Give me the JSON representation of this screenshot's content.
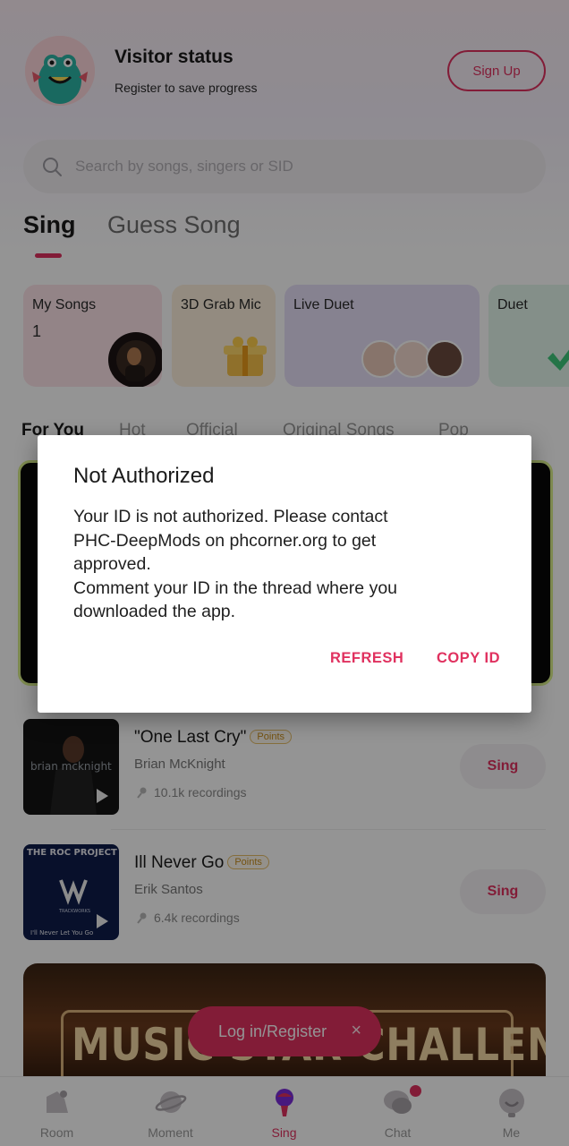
{
  "header": {
    "visitor_title": "Visitor status",
    "visitor_subtitle": "Register to save progress",
    "signup_label": "Sign Up"
  },
  "search": {
    "placeholder": "Search by songs, singers or SID"
  },
  "main_tabs": [
    {
      "label": "Sing",
      "active": true
    },
    {
      "label": "Guess Song",
      "active": false
    }
  ],
  "feature_cards": [
    {
      "label": "My Songs",
      "count": "1"
    },
    {
      "label": "3D Grab Mic"
    },
    {
      "label": "Live Duet"
    },
    {
      "label": "Duet"
    }
  ],
  "category_tabs": [
    {
      "label": "For You",
      "active": true
    },
    {
      "label": "Hot"
    },
    {
      "label": "Official"
    },
    {
      "label": "Original Songs"
    },
    {
      "label": "Pop"
    }
  ],
  "songs": [
    {
      "title": "\"One Last Cry\"",
      "badge": "Points",
      "artist": "Brian McKnight",
      "recordings": "10.1k recordings",
      "action": "Sing",
      "cover_text": "brian mcknight"
    },
    {
      "title": "Ill Never Go",
      "badge": "Points",
      "artist": "Erik Santos",
      "recordings": "6.4k recordings",
      "action": "Sing",
      "cover_text_top": "THE ROC PROJECT",
      "cover_text_bottom": "I'll Never Let You Go",
      "cover_label": "TRACKWORKS"
    }
  ],
  "challenge_banner": {
    "text": "MUSIC STAR CHALLENGE"
  },
  "login_prompt": {
    "label": "Log in/Register",
    "close": "×"
  },
  "bottom_nav": [
    {
      "label": "Room",
      "icon": "room-icon"
    },
    {
      "label": "Moment",
      "icon": "planet-icon"
    },
    {
      "label": "Sing",
      "icon": "mic-icon",
      "active": true
    },
    {
      "label": "Chat",
      "icon": "chat-icon",
      "badge": true
    },
    {
      "label": "Me",
      "icon": "face-icon"
    }
  ],
  "dialog": {
    "title": "Not Authorized",
    "body_lines": [
      "Your ID is not authorized. Please contact",
      "PHC-DeepMods on phcorner.org to get",
      "approved.",
      "Comment your ID in the thread where you",
      "downloaded the app."
    ],
    "refresh_label": "REFRESH",
    "copy_label": "COPY ID"
  },
  "colors": {
    "accent": "#e0315f",
    "scrim": "rgba(0,0,0,0.42)",
    "featured_border": "#d9f08a"
  }
}
